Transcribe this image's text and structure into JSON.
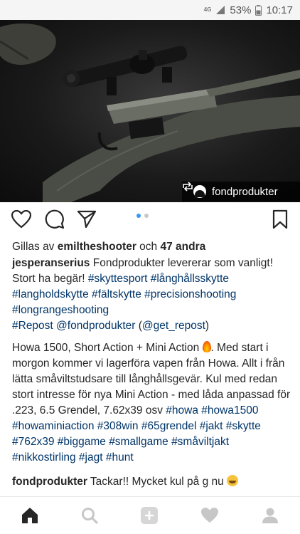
{
  "status_bar": {
    "network": "4G",
    "battery_percent": "53%",
    "time": "10:17"
  },
  "post_image": {
    "repost_account": "fondprodukter",
    "repost_icon": "repost-icon"
  },
  "actions": {
    "like_icon": "heart-icon",
    "comment_icon": "comment-icon",
    "share_icon": "send-icon",
    "save_icon": "bookmark-icon",
    "carousel_active": 1,
    "carousel_total": 2
  },
  "likes": {
    "prefix": "Gillas av ",
    "user": "emiltheshooter",
    "middle": " och ",
    "others": "47 andra"
  },
  "caption": {
    "username": "jesperanserius",
    "p1_text": " Fondprodukter levererar som vanligt! Stort ha begär! ",
    "p1_tags": [
      "#skyttesport",
      "#långhållsskytte",
      "#langholdskytte",
      "#fältskytte",
      "#precisionshooting",
      "#longrangeshooting"
    ],
    "repost_tag": "#Repost",
    "repost_mention": "@fondprodukter",
    "repost_via": "(@get_repost)",
    "p2_text": "Howa 1500, Short Action + Mini Action ",
    "p2_text_after": ". Med start i morgon kommer vi lagerföra vapen från Howa. Allt i från lätta småviltstudsare till långhållsgevär. Kul med redan stort intresse för nya Mini Action - med låda anpassad för .223, 6.5 Grendel, 7.62x39 osv",
    "p2_tags": [
      "#howa",
      "#howa1500",
      "#howaminiaction",
      "#308win",
      "#65grendel",
      "#jakt",
      "#skytte",
      "#762x39",
      "#biggame",
      "#smallgame",
      "#småviltjakt",
      "#nikkostirling",
      "#jagt",
      "#hunt"
    ]
  },
  "comment": {
    "username": "fondprodukter",
    "text": " Tackar!! Mycket kul på g nu "
  },
  "bottom_nav": [
    "home-icon",
    "search-icon",
    "add-icon",
    "activity-heart-icon",
    "profile-icon"
  ],
  "colors": {
    "link": "#003569",
    "text": "#262626",
    "active_dot": "#3897f0"
  }
}
